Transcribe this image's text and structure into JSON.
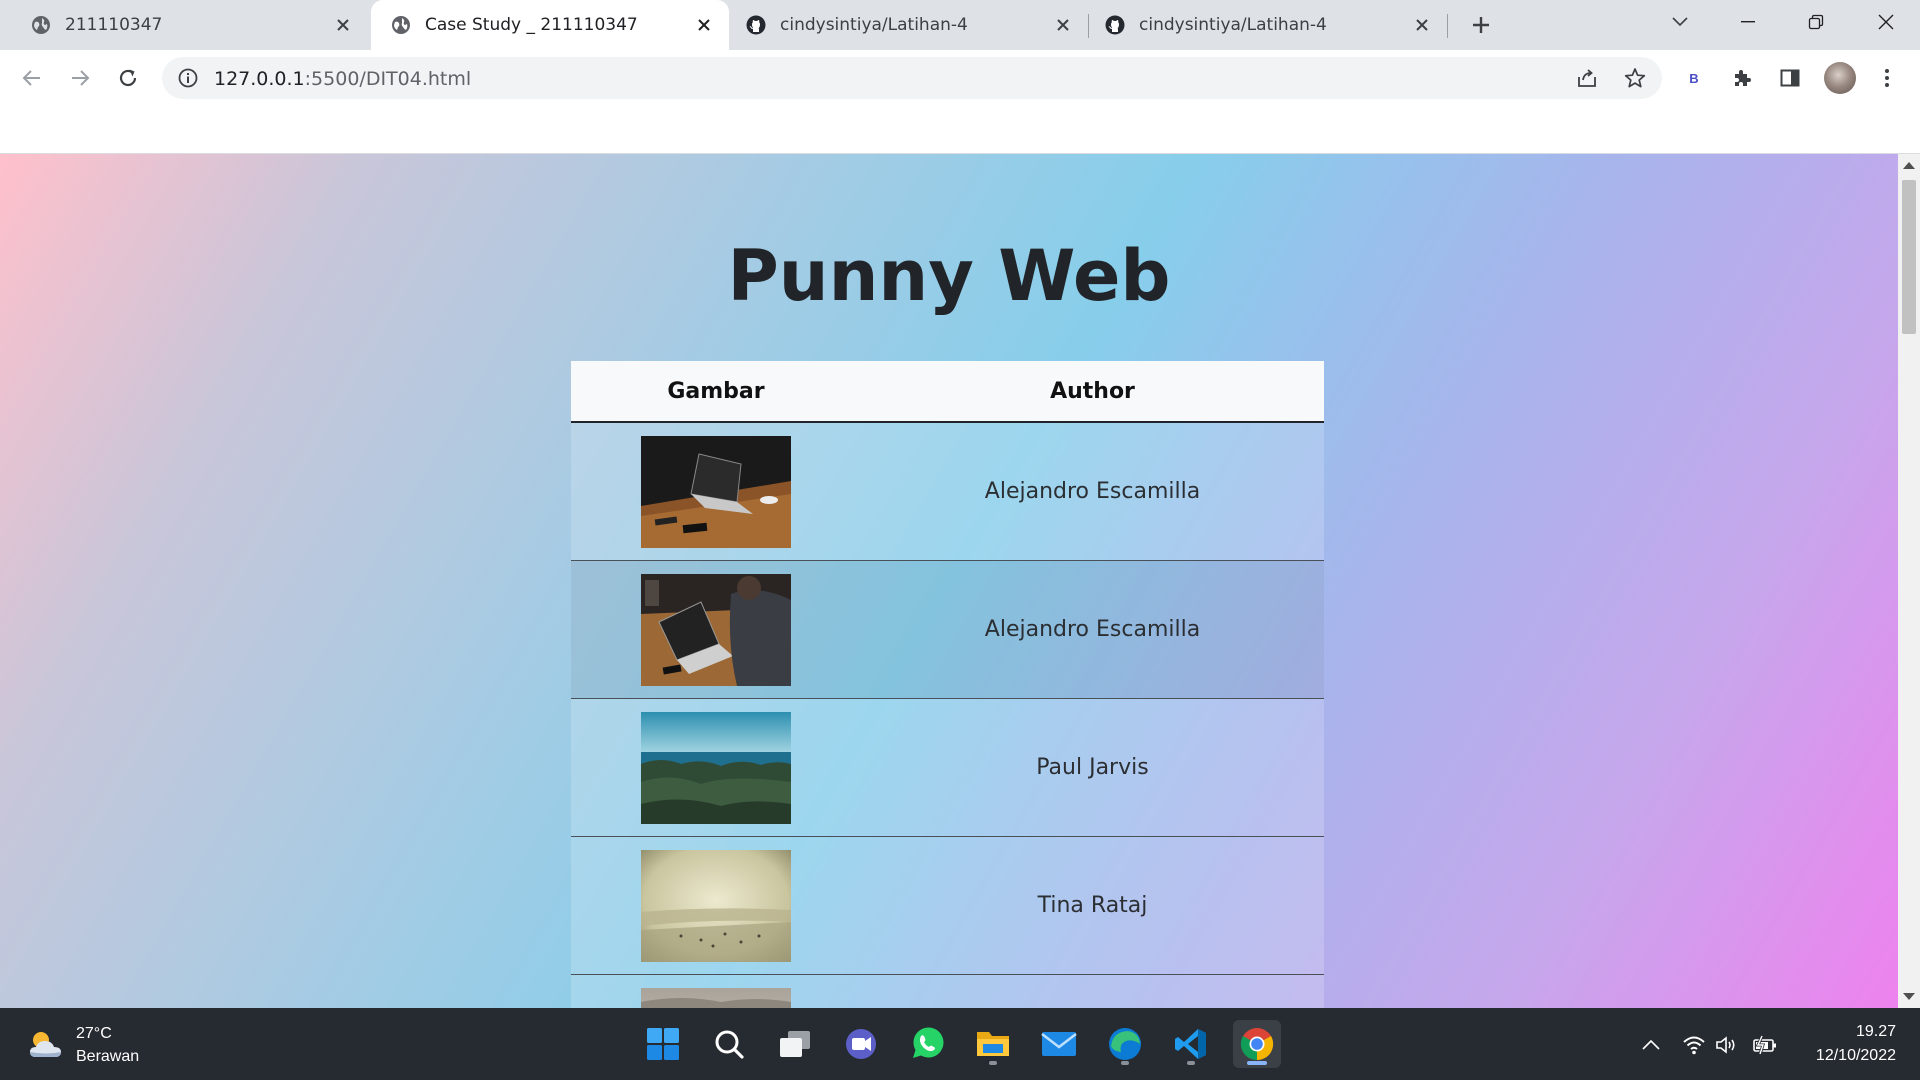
{
  "browser": {
    "tabs": [
      {
        "title": "211110347",
        "icon": "globe-icon",
        "active": false
      },
      {
        "title": "Case Study _ 211110347",
        "icon": "globe-icon",
        "active": true
      },
      {
        "title": "cindysintiya/Latihan-4",
        "icon": "github-icon",
        "active": false
      },
      {
        "title": "cindysintiya/Latihan-4",
        "icon": "github-icon",
        "active": false
      }
    ],
    "address": {
      "host": "127.0.0.1",
      "path": ":5500/DIT04.html"
    },
    "extension_badge": "B"
  },
  "page": {
    "heading": "Punny Web",
    "table": {
      "headers": [
        "Gambar",
        "Author"
      ],
      "rows": [
        {
          "author": "Alejandro Escamilla",
          "image": "laptop on wooden desk"
        },
        {
          "author": "Alejandro Escamilla",
          "image": "person typing on laptop"
        },
        {
          "author": "Paul Jarvis",
          "image": "sea horizon over forest"
        },
        {
          "author": "Tina Rataj",
          "image": "hazy beach with people"
        },
        {
          "author": "",
          "image": "partially visible photo"
        }
      ]
    },
    "background_gradient": [
      "#ffc0cb",
      "#87ceeb",
      "#ee82ee"
    ]
  },
  "taskbar": {
    "weather": {
      "temp": "27°C",
      "condition": "Berawan"
    },
    "apps": [
      "start-icon",
      "search-icon",
      "task-view-icon",
      "chat-icon",
      "whatsapp-icon",
      "file-explorer-icon",
      "mail-icon",
      "edge-icon",
      "vscode-icon",
      "chrome-icon"
    ],
    "clock": {
      "time": "19.27",
      "date": "12/10/2022"
    }
  },
  "colors": {
    "accent": "#8ab4f8",
    "tabstrip": "#dee1e6",
    "taskbar": "#262a31"
  }
}
